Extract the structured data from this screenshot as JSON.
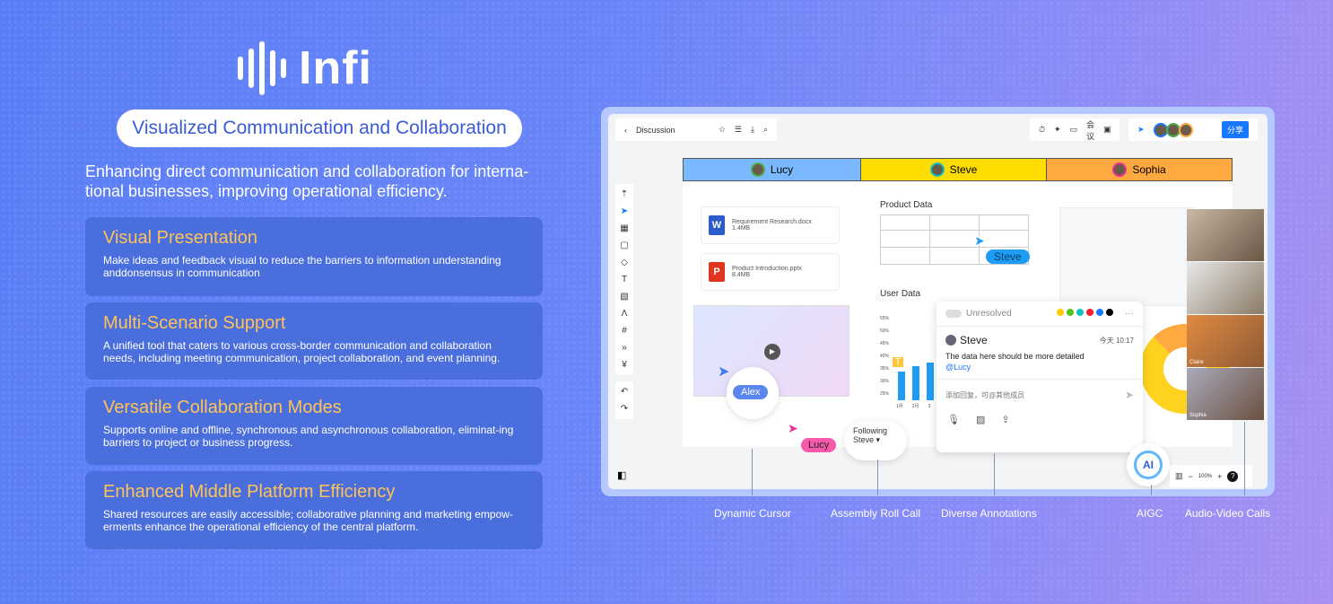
{
  "brand": {
    "name": "Infi",
    "tagline": "Visualized Communication and Collaboration",
    "subtitle": "Enhancing direct communication and collaboration for interna-tional businesses, improving operational efficiency."
  },
  "features": [
    {
      "title": "Visual Presentation",
      "desc": "Make ideas and feedback visual to reduce the barriers to information understanding anddonsensus in communication"
    },
    {
      "title": "Multi-Scenario Support",
      "desc": "A unified tool that caters to various cross-border communication and collaboration needs, including meeting communication, project collaboration, and event planning."
    },
    {
      "title": "Versatile Collaboration Modes",
      "desc": "Supports online and offline, synchronous and asynchronous collaboration, eliminat-ing barriers to project or business progress."
    },
    {
      "title": "Enhanced Middle Platform Efficiency",
      "desc": "Shared resources are easily accessible; collaborative planning and marketing empow-erments enhance the operational efficiency of the central platform."
    }
  ],
  "app": {
    "doc_title": "Discussion",
    "meeting_label": "会议",
    "share_label": "分享",
    "columns": [
      {
        "name": "Lucy",
        "color": "#7ab8ff"
      },
      {
        "name": "Steve",
        "color": "#ffdd00"
      },
      {
        "name": "Sophia",
        "color": "#ffa940"
      }
    ],
    "files": [
      {
        "name": "Requirement Research.docx",
        "size": "1.4MB",
        "type": "W",
        "color": "#2b5cc8"
      },
      {
        "name": "Product Introduction.pptx",
        "size": "8.4MB",
        "type": "P",
        "color": "#e0361f"
      }
    ],
    "product_data": "Product Data",
    "user_data": "User Data",
    "chart_ticks": [
      "55%",
      "50%",
      "45%",
      "40%",
      "35%",
      "30%",
      "25%"
    ],
    "chart_x": [
      "1月",
      "2月",
      "3"
    ],
    "cursors": {
      "alex": "Alex",
      "lucy": "Lucy",
      "steve": "Steve"
    },
    "following": {
      "line1": "Following",
      "line2": "Steve"
    },
    "comment": {
      "status": "Unresolved",
      "author": "Steve",
      "time": "今天 10:17",
      "text": "The data here should be more detailed",
      "mention": "@Lucy",
      "reply_placeholder": "添加回复，可@其他成员",
      "colors": [
        "#ffcc00",
        "#52c41a",
        "#13c2c2",
        "#f5222d",
        "#1677ff",
        "#000000"
      ]
    },
    "video_names": [
      "",
      "",
      "Claire",
      "Sophia"
    ],
    "ai_label": "AI",
    "zoom": "100%"
  },
  "callouts": [
    "Dynamic Cursor",
    "Assembly Roll Call",
    "Diverse Annotations",
    "AIGC",
    "Audio-Video Calls"
  ]
}
